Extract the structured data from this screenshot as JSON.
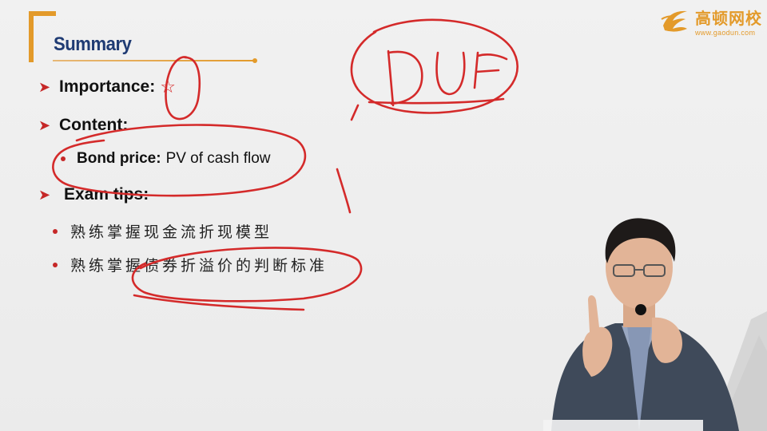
{
  "slide": {
    "title": "Summary",
    "items": [
      {
        "label": "Importance:",
        "icon": "star-icon",
        "glyph": "☆"
      },
      {
        "label": "Content:"
      },
      {
        "label": "Exam tips:"
      }
    ],
    "content_subitem": {
      "strong": "Bond price:",
      "text": "PV of cash flow"
    },
    "tips": [
      "熟练掌握现金流折现模型",
      "熟练掌握债券折溢价的判断标准"
    ]
  },
  "logo": {
    "name": "高顿网校",
    "url": "www.gaodun.com"
  },
  "colors": {
    "title": "#1f3b73",
    "accent": "#e39a2a",
    "bullet": "#c62828",
    "ink": "#d42a2a"
  }
}
